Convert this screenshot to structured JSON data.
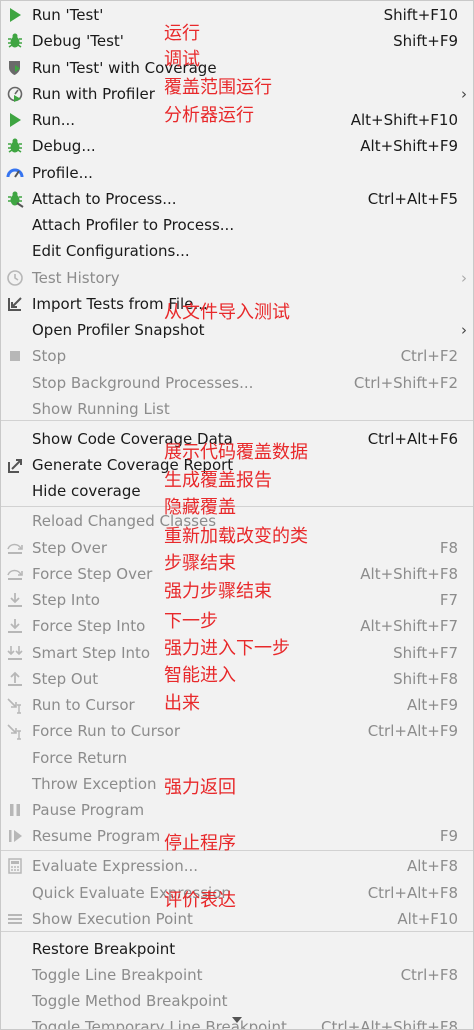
{
  "menu": {
    "items": [
      {
        "name": "run-test",
        "icon": "run-icon",
        "label": "Run 'Test'",
        "shortcut": "Shift+F10",
        "enabled": true
      },
      {
        "name": "debug-test",
        "icon": "debug-icon",
        "label": "Debug 'Test'",
        "shortcut": "Shift+F9",
        "enabled": true
      },
      {
        "name": "run-test-coverage",
        "icon": "coverage-icon",
        "label": "Run 'Test' with Coverage",
        "shortcut": "",
        "enabled": true
      },
      {
        "name": "run-with-profiler",
        "icon": "profiler-icon",
        "label": "Run with Profiler",
        "shortcut": "",
        "enabled": true,
        "submenu": true
      },
      {
        "name": "run",
        "icon": "run-icon",
        "label": "Run...",
        "shortcut": "Alt+Shift+F10",
        "enabled": true
      },
      {
        "name": "debug",
        "icon": "debug-icon",
        "label": "Debug...",
        "shortcut": "Alt+Shift+F9",
        "enabled": true
      },
      {
        "name": "profile",
        "icon": "profile-icon",
        "label": "Profile...",
        "shortcut": "",
        "enabled": true
      },
      {
        "name": "attach-to-process",
        "icon": "attach-icon",
        "label": "Attach to Process...",
        "shortcut": "Ctrl+Alt+F5",
        "enabled": true
      },
      {
        "name": "attach-profiler",
        "icon": "",
        "label": "Attach Profiler to Process...",
        "shortcut": "",
        "enabled": true
      },
      {
        "name": "edit-configurations",
        "icon": "",
        "label": "Edit Configurations...",
        "shortcut": "",
        "enabled": true
      },
      {
        "name": "test-history",
        "icon": "history-icon",
        "label": "Test History",
        "shortcut": "",
        "enabled": false,
        "submenu": true
      },
      {
        "name": "import-tests",
        "icon": "import-icon",
        "label": "Import Tests from File...",
        "shortcut": "",
        "enabled": true
      },
      {
        "name": "open-profiler-snapshot",
        "icon": "",
        "label": "Open Profiler Snapshot",
        "shortcut": "",
        "enabled": true,
        "submenu": true
      },
      {
        "name": "stop",
        "icon": "stop-icon",
        "label": "Stop",
        "shortcut": "Ctrl+F2",
        "enabled": false
      },
      {
        "name": "stop-background",
        "icon": "",
        "label": "Stop Background Processes...",
        "shortcut": "Ctrl+Shift+F2",
        "enabled": false
      },
      {
        "name": "show-running-list",
        "icon": "",
        "label": "Show Running List",
        "shortcut": "",
        "enabled": false
      },
      {
        "name": "show-code-coverage",
        "icon": "",
        "label": "Show Code Coverage Data",
        "shortcut": "Ctrl+Alt+F6",
        "enabled": true,
        "sep_before": true
      },
      {
        "name": "generate-coverage-report",
        "icon": "export-icon",
        "label": "Generate Coverage Report",
        "shortcut": "",
        "enabled": true
      },
      {
        "name": "hide-coverage",
        "icon": "",
        "label": "Hide coverage",
        "shortcut": "",
        "enabled": true
      },
      {
        "name": "reload-changed-classes",
        "icon": "",
        "label": "Reload Changed Classes",
        "shortcut": "",
        "enabled": false,
        "sep_before": true
      },
      {
        "name": "step-over",
        "icon": "step-over-icon",
        "label": "Step Over",
        "shortcut": "F8",
        "enabled": false
      },
      {
        "name": "force-step-over",
        "icon": "step-over-icon",
        "label": "Force Step Over",
        "shortcut": "Alt+Shift+F8",
        "enabled": false
      },
      {
        "name": "step-into",
        "icon": "step-into-icon",
        "label": "Step Into",
        "shortcut": "F7",
        "enabled": false
      },
      {
        "name": "force-step-into",
        "icon": "step-into-icon",
        "label": "Force Step Into",
        "shortcut": "Alt+Shift+F7",
        "enabled": false
      },
      {
        "name": "smart-step-into",
        "icon": "smart-step-icon",
        "label": "Smart Step Into",
        "shortcut": "Shift+F7",
        "enabled": false
      },
      {
        "name": "step-out",
        "icon": "step-out-icon",
        "label": "Step Out",
        "shortcut": "Shift+F8",
        "enabled": false
      },
      {
        "name": "run-to-cursor",
        "icon": "run-to-cursor-icon",
        "label": "Run to Cursor",
        "shortcut": "Alt+F9",
        "enabled": false
      },
      {
        "name": "force-run-to-cursor",
        "icon": "run-to-cursor-icon",
        "label": "Force Run to Cursor",
        "shortcut": "Ctrl+Alt+F9",
        "enabled": false
      },
      {
        "name": "force-return",
        "icon": "",
        "label": "Force Return",
        "shortcut": "",
        "enabled": false
      },
      {
        "name": "throw-exception",
        "icon": "",
        "label": "Throw Exception",
        "shortcut": "",
        "enabled": false
      },
      {
        "name": "pause-program",
        "icon": "pause-icon",
        "label": "Pause Program",
        "shortcut": "",
        "enabled": false
      },
      {
        "name": "resume-program",
        "icon": "resume-icon",
        "label": "Resume Program",
        "shortcut": "F9",
        "enabled": false
      },
      {
        "name": "evaluate-expression",
        "icon": "calculator-icon",
        "label": "Evaluate Expression...",
        "shortcut": "Alt+F8",
        "enabled": false,
        "sep_before": true
      },
      {
        "name": "quick-evaluate",
        "icon": "",
        "label": "Quick Evaluate Expression",
        "shortcut": "Ctrl+Alt+F8",
        "enabled": false
      },
      {
        "name": "show-execution-point",
        "icon": "execution-point-icon",
        "label": "Show Execution Point",
        "shortcut": "Alt+F10",
        "enabled": false
      },
      {
        "name": "restore-breakpoint",
        "icon": "",
        "label": "Restore Breakpoint",
        "shortcut": "",
        "enabled": true,
        "sep_before": true
      },
      {
        "name": "toggle-line-breakpoint",
        "icon": "",
        "label": "Toggle Line Breakpoint",
        "shortcut": "Ctrl+F8",
        "enabled": false
      },
      {
        "name": "toggle-method-breakpoint",
        "icon": "",
        "label": "Toggle Method Breakpoint",
        "shortcut": "",
        "enabled": false
      },
      {
        "name": "toggle-temporary-line-breakpoint",
        "icon": "",
        "label": "Toggle Temporary Line Breakpoint",
        "shortcut": "Ctrl+Alt+Shift+F8",
        "enabled": false
      }
    ]
  },
  "annotations": [
    {
      "row": 1,
      "text": "运行"
    },
    {
      "row": 2,
      "text": "调试"
    },
    {
      "row": 3,
      "text": "覆盖范围运行"
    },
    {
      "row": 4,
      "text": "分析器运行"
    },
    {
      "row": 11,
      "text": "从文件导入测试"
    },
    {
      "row": 16,
      "text": "展示代码覆盖数据"
    },
    {
      "row": 17,
      "text": "生成覆盖报告"
    },
    {
      "row": 18,
      "text": "隐藏覆盖"
    },
    {
      "row": 19,
      "text": "重新加载改变的类"
    },
    {
      "row": 20,
      "text": "步骤结束"
    },
    {
      "row": 21,
      "text": "强力步骤结束"
    },
    {
      "row": 22,
      "text": "下一步"
    },
    {
      "row": 23,
      "text": "强力进入下一步"
    },
    {
      "row": 24,
      "text": "智能进入"
    },
    {
      "row": 25,
      "text": "出来"
    },
    {
      "row": 29,
      "text": "强力返回"
    },
    {
      "row": 31,
      "text": "停止程序"
    },
    {
      "row": 33,
      "text": "评价表达"
    }
  ],
  "colors": {
    "accent_green": "#3fa542",
    "accent_red": "#e8292b",
    "disabled": "#8c8c8c"
  }
}
